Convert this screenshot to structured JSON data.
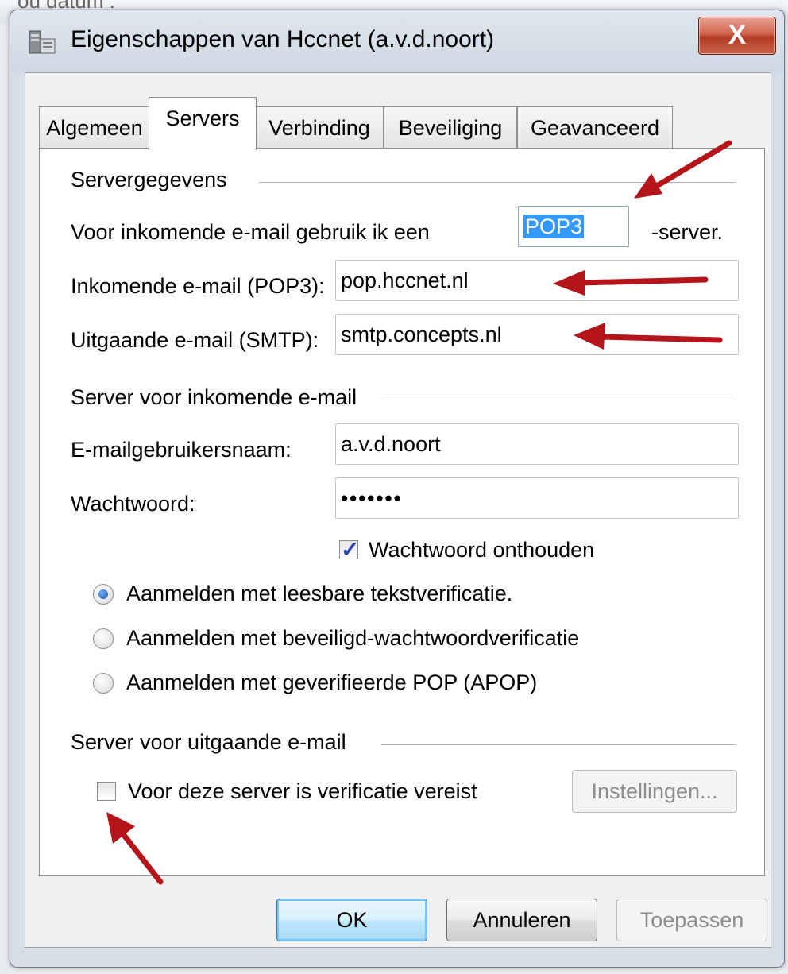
{
  "background": {
    "crumb": "ou datum :"
  },
  "window": {
    "title": "Eigenschappen van Hccnet (a.v.d.noort)",
    "close_label": "X"
  },
  "tabs": [
    {
      "label": "Algemeen",
      "active": false
    },
    {
      "label": "Servers",
      "active": true
    },
    {
      "label": "Verbinding",
      "active": false
    },
    {
      "label": "Beveiliging",
      "active": false
    },
    {
      "label": "Geavanceerd",
      "active": false
    }
  ],
  "server_info": {
    "heading": "Servergegevens",
    "incoming_type_label": "Voor inkomende e-mail gebruik ik een",
    "incoming_type_value": "POP3",
    "incoming_type_suffix": "-server.",
    "incoming_label": "Inkomende e-mail (POP3):",
    "incoming_value": "pop.hccnet.nl",
    "outgoing_label": "Uitgaande e-mail (SMTP):",
    "outgoing_value": "smtp.concepts.nl"
  },
  "incoming_server": {
    "heading": "Server voor inkomende e-mail",
    "username_label": "E-mailgebruikersnaam:",
    "username_value": "a.v.d.noort",
    "password_label": "Wachtwoord:",
    "password_value": "•••••••",
    "remember_label": "Wachtwoord onthouden",
    "remember_checked": true,
    "auth_options": [
      {
        "label": "Aanmelden met leesbare tekstverificatie.",
        "checked": true
      },
      {
        "label": "Aanmelden met beveiligd-wachtwoordverificatie",
        "checked": false
      },
      {
        "label": "Aanmelden met geverifieerde POP (APOP)",
        "checked": false
      }
    ]
  },
  "outgoing_server": {
    "heading": "Server voor uitgaande e-mail",
    "auth_required_label": "Voor deze server is verificatie vereist",
    "auth_required_checked": false,
    "settings_button": "Instellingen..."
  },
  "buttons": {
    "ok": "OK",
    "cancel": "Annuleren",
    "apply": "Toepassen"
  },
  "colors": {
    "arrow": "#b3151b",
    "selection": "#3399ff"
  }
}
